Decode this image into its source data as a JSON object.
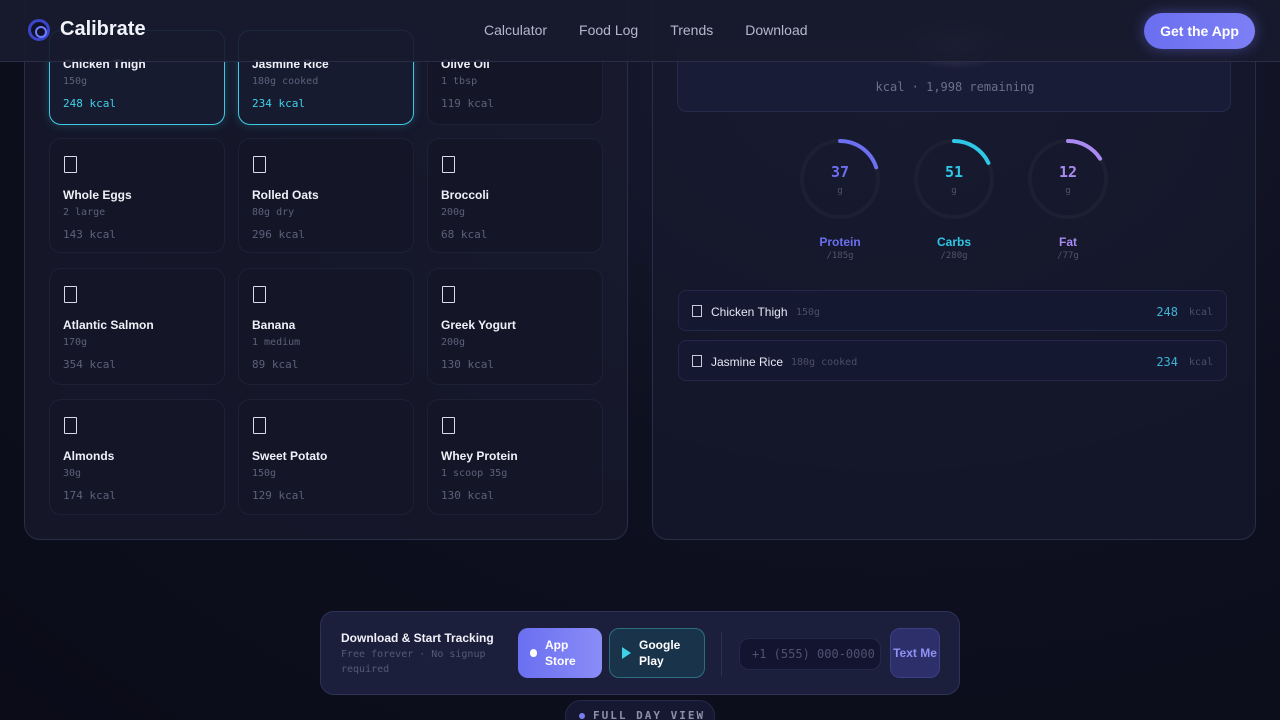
{
  "nav": {
    "brand": "Calibrate",
    "links": [
      "Calculator",
      "Food Log",
      "Trends",
      "Download"
    ],
    "cta": "Get the App"
  },
  "foods": [
    {
      "name": "Chicken Thigh",
      "portion": "150g",
      "kcal": "248 kcal",
      "selected": true
    },
    {
      "name": "Jasmine Rice",
      "portion": "180g cooked",
      "kcal": "234 kcal",
      "selected": true
    },
    {
      "name": "Olive Oil",
      "portion": "1 tbsp",
      "kcal": "119 kcal",
      "selected": false
    },
    {
      "name": "Whole Eggs",
      "portion": "2 large",
      "kcal": "143 kcal",
      "selected": false
    },
    {
      "name": "Rolled Oats",
      "portion": "80g dry",
      "kcal": "296 kcal",
      "selected": false
    },
    {
      "name": "Broccoli",
      "portion": "200g",
      "kcal": "68 kcal",
      "selected": false
    },
    {
      "name": "Atlantic Salmon",
      "portion": "170g",
      "kcal": "354 kcal",
      "selected": false
    },
    {
      "name": "Banana",
      "portion": "1 medium",
      "kcal": "89 kcal",
      "selected": false
    },
    {
      "name": "Greek Yogurt",
      "portion": "200g",
      "kcal": "130 kcal",
      "selected": false
    },
    {
      "name": "Almonds",
      "portion": "30g",
      "kcal": "174 kcal",
      "selected": false
    },
    {
      "name": "Sweet Potato",
      "portion": "150g",
      "kcal": "129 kcal",
      "selected": false
    },
    {
      "name": "Whey Protein",
      "portion": "1 scoop 35g",
      "kcal": "130 kcal",
      "selected": false
    }
  ],
  "summary": {
    "remaining": "kcal · 1,998 remaining"
  },
  "macros": [
    {
      "name": "Protein",
      "value": "37",
      "unit": "g",
      "goal": "/185g",
      "progress": 0.2,
      "color": "#6b6ff0"
    },
    {
      "name": "Carbs",
      "value": "51",
      "unit": "g",
      "goal": "/280g",
      "progress": 0.18,
      "color": "#2fc7e6"
    },
    {
      "name": "Fat",
      "value": "12",
      "unit": "g",
      "goal": "/77g",
      "progress": 0.16,
      "color": "#a98af2"
    }
  ],
  "log": [
    {
      "name": "Chicken Thigh",
      "portion": "150g",
      "kcal": "248",
      "unit": "kcal"
    },
    {
      "name": "Jasmine Rice",
      "portion": "180g cooked",
      "kcal": "234",
      "unit": "kcal"
    }
  ],
  "download": {
    "title": "Download & Start Tracking",
    "subtitle": "Free forever · No signup required",
    "app_store": "App Store",
    "google_play": "Google Play",
    "phone_placeholder": "+1 (555) 000-0000",
    "text_me": "Text Me"
  },
  "full_day": "FULL DAY VIEW"
}
